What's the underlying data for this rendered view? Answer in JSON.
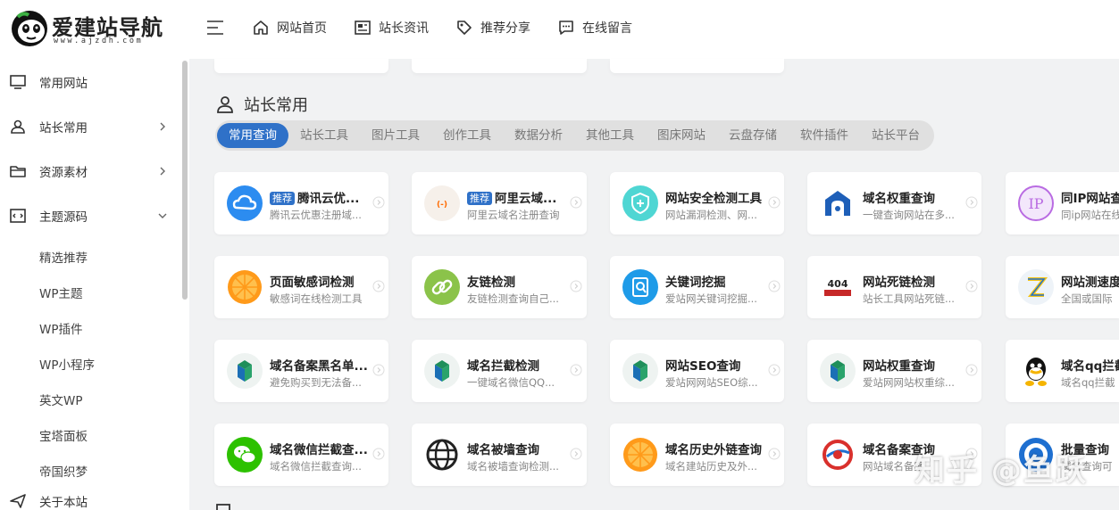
{
  "header": {
    "logo_title": "爱建站导航",
    "logo_sub": "www.ajzdh.com",
    "nav": [
      {
        "label": "网站首页",
        "icon": "home-icon"
      },
      {
        "label": "站长资讯",
        "icon": "newspaper-icon"
      },
      {
        "label": "推荐分享",
        "icon": "tag-icon"
      },
      {
        "label": "在线留言",
        "icon": "message-icon"
      }
    ]
  },
  "sidebar": {
    "items": [
      {
        "label": "常用网站",
        "icon": "monitor-icon"
      },
      {
        "label": "站长常用",
        "icon": "user-icon"
      },
      {
        "label": "资源素材",
        "icon": "folder-icon"
      },
      {
        "label": "主题源码",
        "icon": "code-icon"
      }
    ],
    "subitems": [
      "精选推荐",
      "WP主题",
      "WP插件",
      "WP小程序",
      "英文WP",
      "宝塔面板",
      "帝国织梦"
    ],
    "about": {
      "label": "关于本站",
      "icon": "send-icon"
    }
  },
  "section": {
    "title": "站长常用",
    "tabs": [
      "常用查询",
      "站长工具",
      "图片工具",
      "创作工具",
      "数据分析",
      "其他工具",
      "图床网站",
      "云盘存储",
      "软件插件",
      "站长平台"
    ],
    "active_tab": "常用查询"
  },
  "badge": "推荐",
  "cards": [
    [
      {
        "title": "腾讯云优...",
        "desc": "腾讯云优惠注册域...",
        "badge": true,
        "icon": "tencent-cloud-icon"
      },
      {
        "title": "阿里云域...",
        "desc": "阿里云域名注册查询",
        "badge": true,
        "icon": "aliyun-icon"
      },
      {
        "title": "网站安全检测工具",
        "desc": "网站漏洞检测、网...",
        "badge": false,
        "icon": "shield-icon"
      },
      {
        "title": "域名权重查询",
        "desc": "一键查询网站在多...",
        "badge": false,
        "icon": "domain-weight-icon"
      },
      {
        "title": "同IP网站查",
        "desc": "同ip网站在线",
        "badge": false,
        "icon": "ip-icon"
      }
    ],
    [
      {
        "title": "页面敏感词检测",
        "desc": "敏感词在线检测工具",
        "badge": false,
        "icon": "orange-icon"
      },
      {
        "title": "友链检测",
        "desc": "友链检测查询自己...",
        "badge": false,
        "icon": "link-icon"
      },
      {
        "title": "关键词挖掘",
        "desc": "爱站网关键词挖掘...",
        "badge": false,
        "icon": "keyword-icon"
      },
      {
        "title": "网站死链检测",
        "desc": "站长工具网站死链...",
        "badge": false,
        "icon": "404-icon"
      },
      {
        "title": "网站测速度",
        "desc": "全国或国际",
        "badge": false,
        "icon": "speed-icon"
      }
    ],
    [
      {
        "title": "域名备案黑名单...",
        "desc": "避免购买到无法备...",
        "badge": false,
        "icon": "aizhan-icon"
      },
      {
        "title": "域名拦截检测",
        "desc": "一键域名微信QQ...",
        "badge": false,
        "icon": "aizhan-icon"
      },
      {
        "title": "网站SEO查询",
        "desc": "爱站网网站SEO综...",
        "badge": false,
        "icon": "aizhan-icon"
      },
      {
        "title": "网站权重查询",
        "desc": "爱站网网站权重综...",
        "badge": false,
        "icon": "aizhan-icon"
      },
      {
        "title": "域名qq拦截",
        "desc": "域名qq拦截",
        "badge": false,
        "icon": "qq-icon"
      }
    ],
    [
      {
        "title": "域名微信拦截查...",
        "desc": "域名微信拦截查询...",
        "badge": false,
        "icon": "wechat-icon"
      },
      {
        "title": "域名被墙查询",
        "desc": "域名被墙查询检测...",
        "badge": false,
        "icon": "globe-icon"
      },
      {
        "title": "域名历史外链查询",
        "desc": "域名建站历史及外...",
        "badge": false,
        "icon": "orange-icon"
      },
      {
        "title": "域名备案查询",
        "desc": "网站域名备案",
        "badge": false,
        "icon": "beian-icon"
      },
      {
        "title": "批量查询",
        "desc": "域名查询可",
        "badge": false,
        "icon": "batch-icon"
      }
    ]
  ],
  "watermark": "知乎 @鱼跃",
  "colors": {
    "accent": "#2f71c8",
    "background": "#f1f2f3",
    "card": "#ffffff"
  }
}
